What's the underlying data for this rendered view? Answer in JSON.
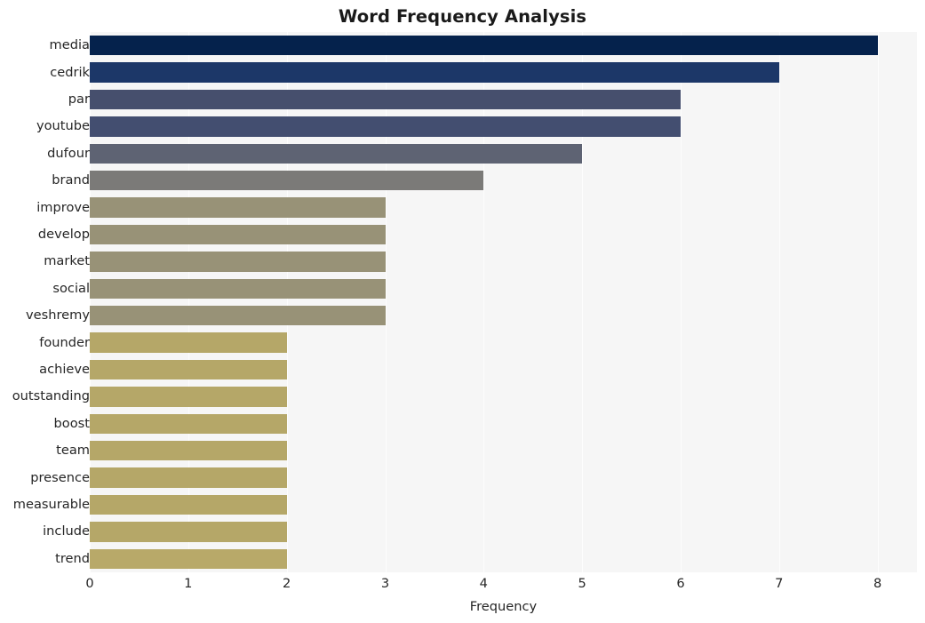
{
  "chart_data": {
    "type": "bar",
    "orientation": "horizontal",
    "title": "Word Frequency Analysis",
    "xlabel": "Frequency",
    "ylabel": "",
    "xlim": [
      0,
      8.4
    ],
    "xticks": [
      "0",
      "1",
      "2",
      "3",
      "4",
      "5",
      "6",
      "7",
      "8"
    ],
    "xtick_values": [
      0,
      1,
      2,
      3,
      4,
      5,
      6,
      7,
      8
    ],
    "grid": "vertical-only",
    "legend": "none",
    "plot_background": "#f6f6f6",
    "figure_background": "#ffffff",
    "gridline_color": "#fdfdfd",
    "categories": [
      "media",
      "cedrik",
      "par",
      "youtube",
      "dufour",
      "brand",
      "improve",
      "develop",
      "market",
      "social",
      "veshremy",
      "founder",
      "achieve",
      "outstanding",
      "boost",
      "team",
      "presence",
      "measurable",
      "include",
      "trend"
    ],
    "values": [
      8,
      7,
      6,
      6,
      5,
      4,
      3,
      3,
      3,
      3,
      3,
      2,
      2,
      2,
      2,
      2,
      2,
      2,
      2,
      2
    ],
    "bar_colors": [
      "#05224c",
      "#1c3768",
      "#464f6d",
      "#434e70",
      "#5e6373",
      "#7b7a78",
      "#989277",
      "#989277",
      "#989277",
      "#989277",
      "#989277",
      "#b5a768",
      "#b5a768",
      "#b5a768",
      "#b5a768",
      "#b5a768",
      "#b5a768",
      "#b5a768",
      "#b5a768",
      "#b8a969"
    ]
  }
}
